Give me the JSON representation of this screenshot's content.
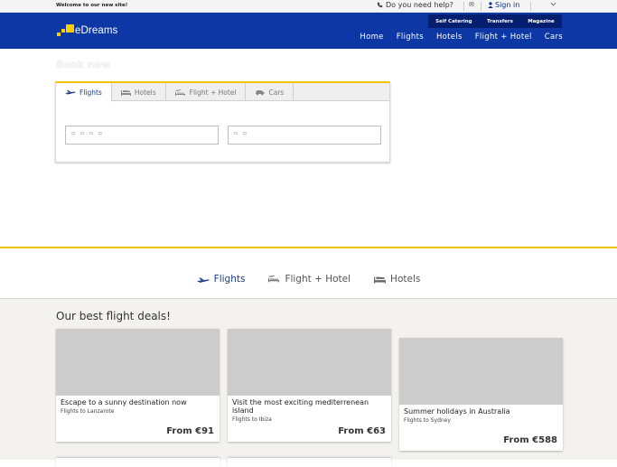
{
  "topbar": {
    "welcome": "Welcome to our new site!",
    "help": "Do you need help?",
    "signin": "Sign in"
  },
  "brand": {
    "name": "eDreams",
    "accent": "#ffcc00",
    "header_bg": "#0c37a4"
  },
  "subnav": [
    "Self Catering",
    "Transfers",
    "Magazine"
  ],
  "mainnav": [
    "Home",
    "Flights",
    "Hotels",
    "Flight + Hotel",
    "Cars"
  ],
  "book": {
    "title": "Book now",
    "tabs": [
      "Flights",
      "Hotels",
      "Flight + Hotel",
      "Cars"
    ],
    "input1": "▫ ▫ ▫ ▫",
    "input2": "▫ ▫"
  },
  "product_tabs": [
    "Flights",
    "Flight + Hotel",
    "Hotels"
  ],
  "deals": {
    "title": "Our best flight deals!",
    "cards": [
      {
        "title": "Escape to a sunny destination now",
        "subtitle": "Flights to Lanzarote",
        "price": "From €91"
      },
      {
        "title": "Visit the most exciting mediterrenean island",
        "subtitle": "Flights to Ibiza",
        "price": "From €63"
      },
      {
        "title": "Summer holidays in Australia",
        "subtitle": "Flights to Sydney",
        "price": "From €588"
      }
    ]
  }
}
